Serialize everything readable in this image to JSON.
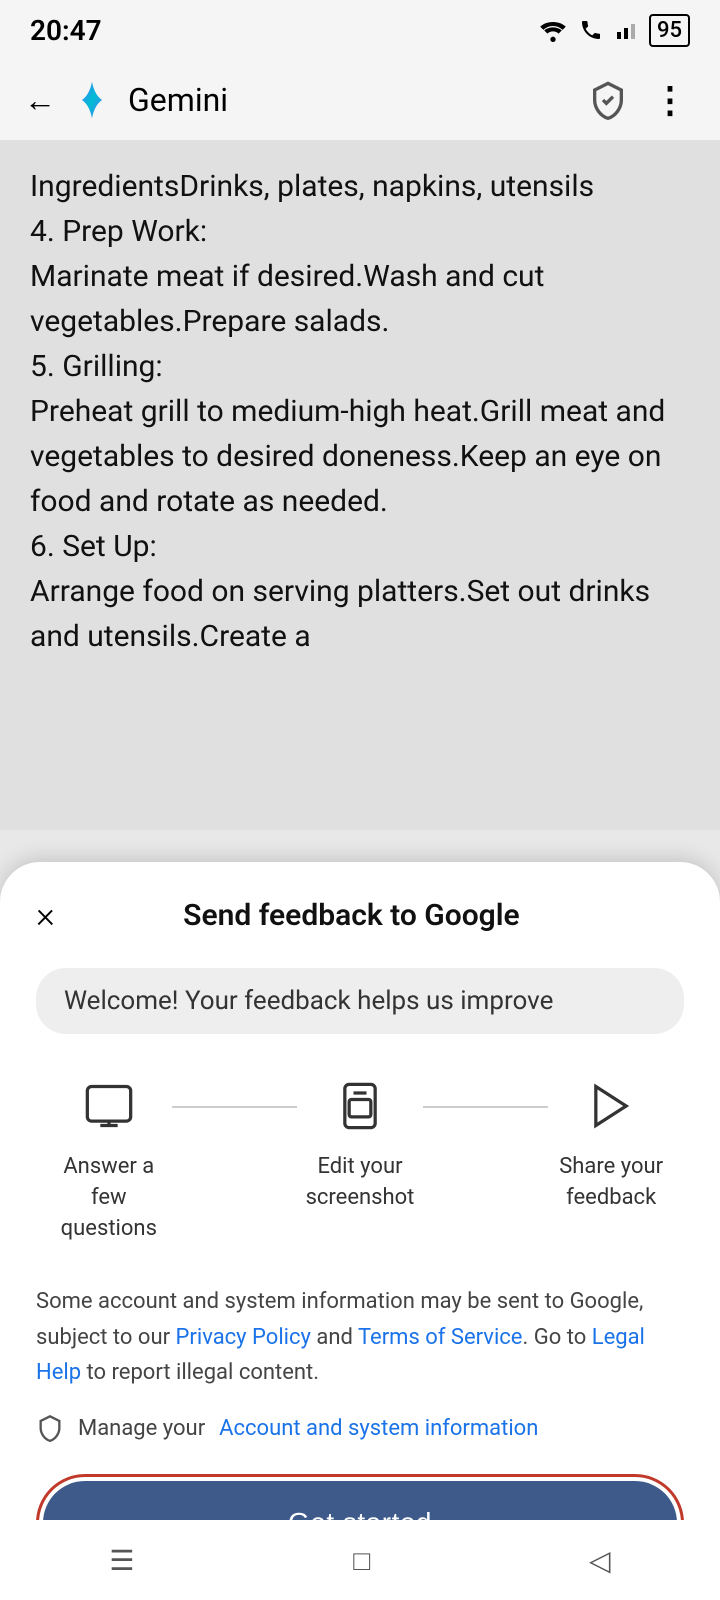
{
  "statusBar": {
    "time": "20:47",
    "battery": "95"
  },
  "appBar": {
    "backLabel": "←",
    "title": "Gemini",
    "moreLabel": "⋮"
  },
  "content": {
    "text": "IngredientsDrinks, plates, napkins, utensils\n4. Prep Work:\nMarinate meat if desired.Wash and cut vegetables.Prepare salads.\n5. Grilling:\nPreheat grill to medium-high heat.Grill meat and vegetables to desired doneness.Keep an eye on food and rotate as needed.\n6. Set Up:\nArrange food on serving platters.Set out drinks and utensils.Create a"
  },
  "bottomSheet": {
    "title": "Send feedback to Google",
    "closeBtnLabel": "×",
    "welcomeBadge": "Welcome! Your feedback helps us improve",
    "steps": [
      {
        "id": "answer",
        "label": "Answer a few questions",
        "iconType": "chat"
      },
      {
        "id": "screenshot",
        "label": "Edit your screenshot",
        "iconType": "phone"
      },
      {
        "id": "share",
        "label": "Share your feedback",
        "iconType": "send"
      }
    ],
    "legalText": "Some account and system information may be sent to Google, subject to our ",
    "privacyPolicyLink": "Privacy Policy",
    "andText": " and ",
    "termsLink": "Terms of Service",
    "legalText2": ". Go to ",
    "legalHelpLink": "Legal Help",
    "legalText3": " to report illegal content.",
    "accountRowText": "Manage your ",
    "accountLink": "Account and system information",
    "getStartedLabel": "Get started"
  },
  "navBar": {
    "menuIcon": "☰",
    "homeIcon": "□",
    "backIcon": "◁"
  }
}
